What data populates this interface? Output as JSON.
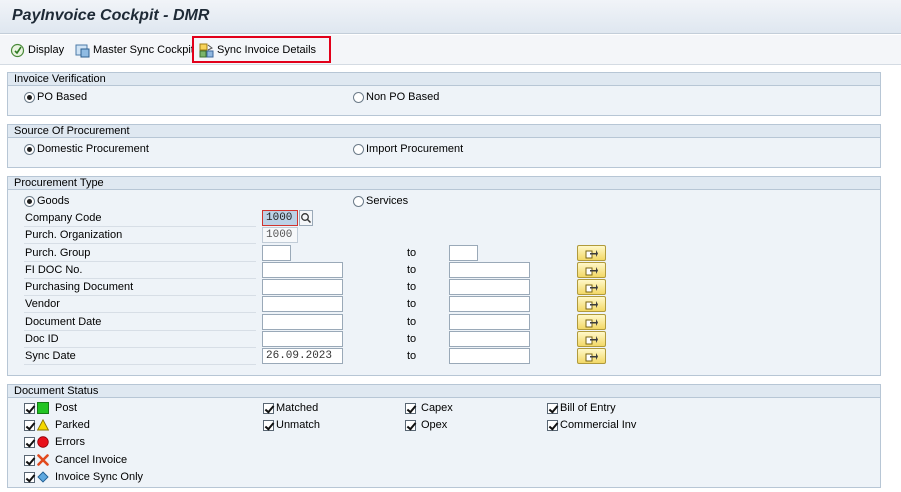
{
  "window": {
    "title": "PayInvoice Cockpit - DMR"
  },
  "toolbar": {
    "display_label": "Display",
    "master_sync_label": "Master Sync Cockpit",
    "sync_invoice_label": "Sync Invoice Details"
  },
  "invoice_verification": {
    "title": "Invoice Verification",
    "po_based": "PO Based",
    "non_po_based": "Non PO Based",
    "selected": "PO Based"
  },
  "source_of_procurement": {
    "title": "Source Of Procurement",
    "domestic": "Domestic Procurement",
    "import": "Import Procurement",
    "selected": "Domestic Procurement"
  },
  "procurement_type": {
    "title": "Procurement Type",
    "goods": "Goods",
    "services": "Services",
    "selected": "Goods",
    "to_label": "to",
    "fields": {
      "company_code": {
        "label": "Company Code",
        "value": "1000"
      },
      "purch_org": {
        "label": "Purch. Organization",
        "value": "1000"
      },
      "purch_group": {
        "label": "Purch. Group",
        "from": "",
        "to": ""
      },
      "fi_doc": {
        "label": "FI DOC No.",
        "from": "",
        "to": ""
      },
      "purch_doc": {
        "label": "Purchasing Document",
        "from": "",
        "to": ""
      },
      "vendor": {
        "label": "Vendor",
        "from": "",
        "to": ""
      },
      "doc_date": {
        "label": "Document Date",
        "from": "",
        "to": ""
      },
      "doc_id": {
        "label": "Doc ID",
        "from": "",
        "to": ""
      },
      "sync_date": {
        "label": "Sync Date",
        "from": "26.09.2023",
        "to": ""
      }
    }
  },
  "document_status": {
    "title": "Document Status",
    "col1": [
      "Post",
      "Parked",
      "Errors",
      "Cancel Invoice",
      "Invoice Sync Only"
    ],
    "col2": [
      "Matched",
      "Unmatch"
    ],
    "col3": [
      "Capex",
      "Opex"
    ],
    "col4": [
      "Bill of Entry",
      "Commercial Inv"
    ],
    "all_checked": true
  },
  "colors": {
    "post": "#22c422",
    "parked": "#f5d800",
    "errors": "#e8101a",
    "cancel": "#e14a1e",
    "sync_only": "#5ea9e0",
    "highlight": "#e2001a"
  }
}
